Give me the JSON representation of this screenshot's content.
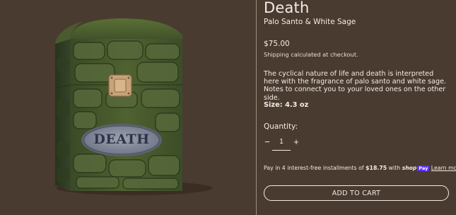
{
  "product": {
    "title": "Death",
    "subtitle": "Palo Santo & White Sage",
    "price": "$75.00",
    "shipping_note": "Shipping calculated at checkout.",
    "description": "The cyclical nature of life and death is interpreted here with the fragrance of palo santo and white sage. Notes to connect you to your loved ones on the other side.",
    "size": "Size: 4.3 oz",
    "image_label": "DEATH"
  },
  "quantity": {
    "label": "Quantity:",
    "value": "1",
    "minus": "−",
    "plus": "+"
  },
  "installments": {
    "prefix": "Pay in 4 interest-free installments of",
    "amount": "$18.75",
    "with": "with",
    "brand_shop": "shop",
    "brand_pay": "Pay",
    "learn_more": "Learn more"
  },
  "cart": {
    "button_label": "ADD TO CART"
  },
  "colors": {
    "background": "#4a3b30",
    "text": "#f2ece5",
    "shop_pay": "#5a31f4"
  }
}
